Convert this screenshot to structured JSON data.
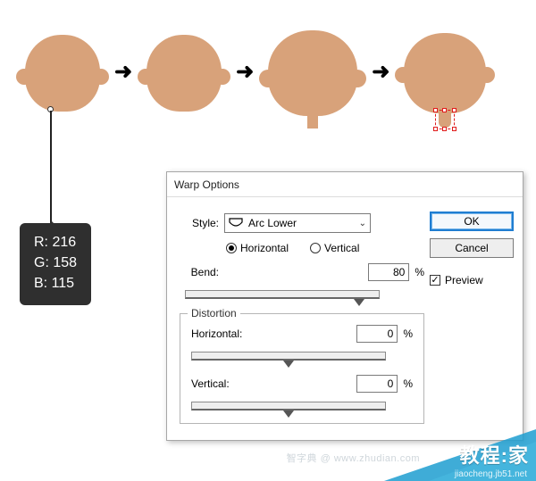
{
  "canvas": {
    "color_tip": {
      "r_line": "R: 216",
      "g_line": "G: 158",
      "b_line": "B: 115",
      "hex": "#d89e73"
    }
  },
  "dialog": {
    "title": "Warp Options",
    "style_label": "Style:",
    "style_value": "Arc Lower",
    "orientation": {
      "horizontal": "Horizontal",
      "vertical": "Vertical",
      "selected": "horizontal"
    },
    "bend": {
      "label": "Bend:",
      "value": "80",
      "pct": "%",
      "slider_pos": 0.9
    },
    "distortion": {
      "group_label": "Distortion",
      "horizontal": {
        "label": "Horizontal:",
        "value": "0",
        "pct": "%",
        "slider_pos": 0.5
      },
      "vertical": {
        "label": "Vertical:",
        "value": "0",
        "pct": "%",
        "slider_pos": 0.5
      }
    },
    "buttons": {
      "ok": "OK",
      "cancel": "Cancel"
    },
    "preview": {
      "label": "Preview",
      "checked": true
    }
  },
  "watermark": {
    "brand": "教程:家",
    "zd_note": "智字典 @ www.zhudian.com",
    "sub": "jiaocheng.jb51.net"
  }
}
